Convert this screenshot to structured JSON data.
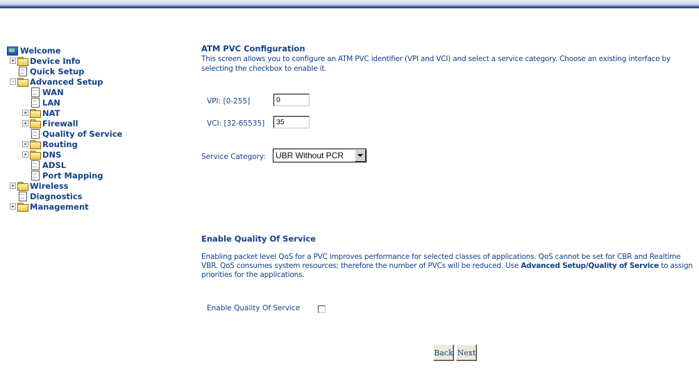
{
  "nav": {
    "welcome": "Welcome",
    "device_info": "Device Info",
    "quick_setup": "Quick Setup",
    "advanced_setup": "Advanced Setup",
    "wan": "WAN",
    "lan": "LAN",
    "nat": "NAT",
    "firewall": "Firewall",
    "qos": "Quality of Service",
    "routing": "Routing",
    "dns": "DNS",
    "adsl": "ADSL",
    "port_mapping": "Port Mapping",
    "wireless": "Wireless",
    "diagnostics": "Diagnostics",
    "management": "Management",
    "expander_plus": "+",
    "expander_minus": "-"
  },
  "atm": {
    "title": "ATM PVC Configuration",
    "description": "This screen allows you to configure an ATM PVC identifier (VPI and VCI) and select a service category. Choose an existing interface by selecting the checkbox to enable it.",
    "vpi_label": "VPI: [0-255]",
    "vpi_value": "0",
    "vci_label": "VCI: [32-65535]",
    "vci_value": "35",
    "service_label": "Service Category:",
    "service_value": "UBR Without PCR"
  },
  "qos": {
    "title": "Enable Quality Of Service",
    "desc_part1": "Enabling packet level QoS for a PVC improves performance for selected classes of applications.  QoS cannot be set for CBR and Realtime VBR.  QoS consumes system resources; therefore the number of PVCs will be reduced. Use ",
    "desc_bold": "Advanced Setup/Quality of Service",
    "desc_part2": " to assign priorities for the applications.",
    "checkbox_label": "Enable Quality Of Service"
  },
  "buttons": {
    "back": "Back",
    "next": "Next"
  },
  "colors": {
    "text": "#123f86",
    "banner": "#1f3f86"
  }
}
